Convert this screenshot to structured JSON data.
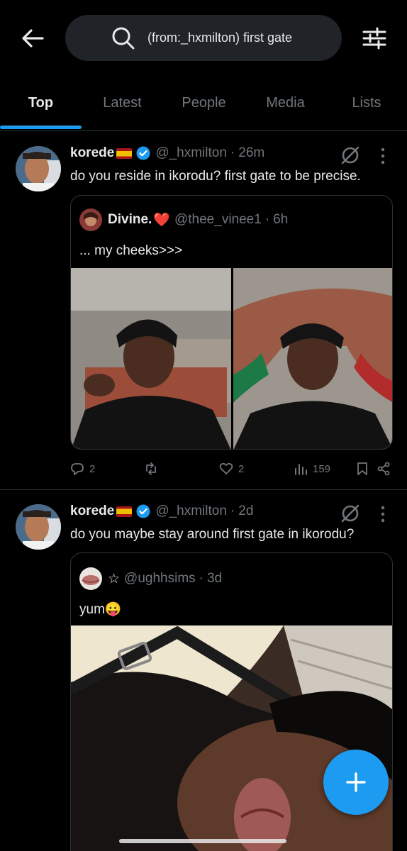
{
  "search": {
    "query": "(from:_hxmilton) first gate"
  },
  "tabs": [
    {
      "label": "Top"
    },
    {
      "label": "Latest"
    },
    {
      "label": "People"
    },
    {
      "label": "Media"
    },
    {
      "label": "Lists"
    }
  ],
  "tweets": [
    {
      "name": "korede",
      "handle": "@_hxmilton",
      "time": "26m",
      "text": "do you reside in ikorodu? first gate to be precise.",
      "quote": {
        "name": "Divine.",
        "emoji": "❤️",
        "handle": "@thee_vinee1",
        "time": "6h",
        "text": "... my cheeks>>>"
      },
      "stats": {
        "replies": "2",
        "reposts": "",
        "likes": "2",
        "views": "159"
      }
    },
    {
      "name": "korede",
      "handle": "@_hxmilton",
      "time": "2d",
      "text": "do you maybe stay around first gate in ikorodu?",
      "quote": {
        "name": "☆",
        "handle": "@ughhsims",
        "time": "3d",
        "text": "yum😛"
      }
    }
  ],
  "colors": {
    "accent": "#1d9bf0",
    "background": "#000000",
    "muted": "#71767b",
    "border": "#2f3336"
  },
  "icons": [
    "back-arrow-icon",
    "search-icon",
    "filter-icon",
    "verified-icon",
    "grok-icon",
    "more-icon",
    "reply-icon",
    "repost-icon",
    "like-icon",
    "views-icon",
    "bookmark-icon",
    "share-icon",
    "compose-icon"
  ]
}
